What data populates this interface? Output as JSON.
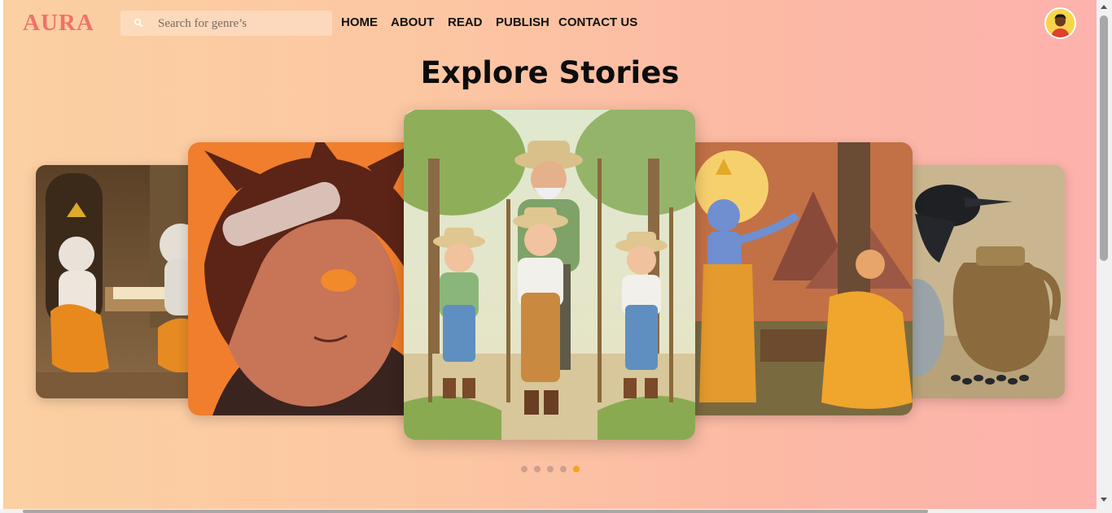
{
  "header": {
    "logo": "AURA",
    "search": {
      "placeholder": "Search for genre’s",
      "icon": "search-icon"
    },
    "nav": [
      "HOME",
      "ABOUT",
      "READ",
      "PUBLISH",
      "CONTACT US"
    ],
    "avatar_icon": "user-avatar-icon"
  },
  "main": {
    "title": "Explore Stories",
    "carousel": {
      "cards": [
        {
          "image": "ganesha-writing-illustration"
        },
        {
          "image": "anime-boy-portrait"
        },
        {
          "image": "farmer-and-three-boys-illustration"
        },
        {
          "image": "krishna-and-devotee-illustration"
        },
        {
          "image": "crow-and-pitcher-illustration"
        }
      ],
      "dots": 5,
      "active_dot_index": 4
    }
  },
  "colors": {
    "logo": "#f07168",
    "active_dot": "#f5a21f",
    "inactive_dot": "#cf9f8c",
    "background_start": "#fbd0a2",
    "background_end": "#fdb2ad"
  }
}
